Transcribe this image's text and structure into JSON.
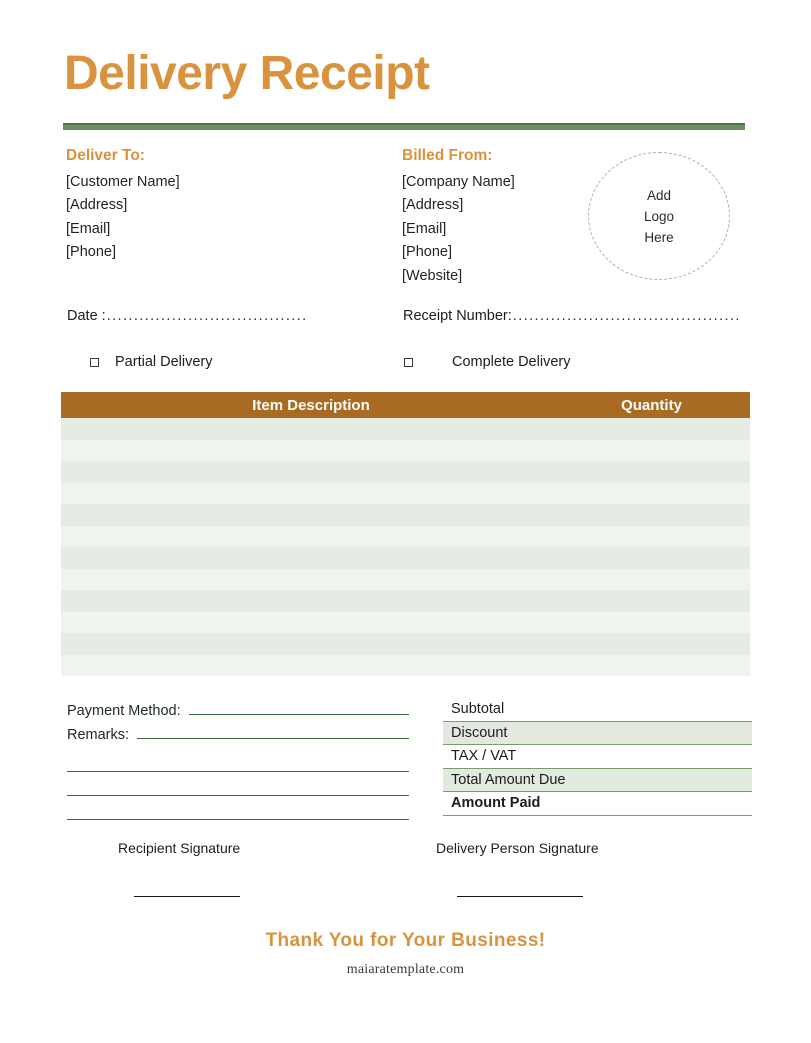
{
  "document": {
    "title": "Delivery Receipt"
  },
  "colors": {
    "accent_orange": "#d9933f",
    "rule_green": "#6b8e5e",
    "table_header_brown": "#a96b22",
    "row_shade_dark": "#e6ece3",
    "row_shade_light": "#f0f4ef",
    "logo_dash": "#9fb3b8",
    "underline_green": "#3c6b3c"
  },
  "deliver_to": {
    "heading": "Deliver To:",
    "lines": [
      "[Customer Name]",
      "[Address]",
      "[Email]",
      "[Phone]"
    ]
  },
  "billed_from": {
    "heading": "Billed From:",
    "lines": [
      "[Company Name]",
      "[Address]",
      "[Email]",
      "[Phone]",
      "[Website]"
    ]
  },
  "logo": {
    "line1": "Add",
    "line2": "Logo",
    "line3": "Here"
  },
  "meta": {
    "date_label": "Date :",
    "date_leader": "..................................................",
    "receipt_label": "Receipt Number:",
    "receipt_leader": "........................................................."
  },
  "delivery_type": {
    "partial_label": "Partial Delivery",
    "complete_label": "Complete Delivery"
  },
  "items_table": {
    "columns": [
      "Item Description",
      "Quantity"
    ],
    "row_count": 12,
    "rows": [
      {
        "description": "",
        "quantity": ""
      },
      {
        "description": "",
        "quantity": ""
      },
      {
        "description": "",
        "quantity": ""
      },
      {
        "description": "",
        "quantity": ""
      },
      {
        "description": "",
        "quantity": ""
      },
      {
        "description": "",
        "quantity": ""
      },
      {
        "description": "",
        "quantity": ""
      },
      {
        "description": "",
        "quantity": ""
      },
      {
        "description": "",
        "quantity": ""
      },
      {
        "description": "",
        "quantity": ""
      },
      {
        "description": "",
        "quantity": ""
      },
      {
        "description": "",
        "quantity": ""
      }
    ]
  },
  "payment": {
    "method_label": "Payment Method:",
    "method_value": "",
    "remarks_label": "Remarks:",
    "remarks_value": "",
    "extra_line_count": 3
  },
  "totals": {
    "rows": [
      {
        "label": "Subtotal",
        "value": "",
        "shaded": false,
        "bold": false
      },
      {
        "label": "Discount",
        "value": "",
        "shaded": true,
        "bold": false
      },
      {
        "label": "TAX / VAT",
        "value": "",
        "shaded": false,
        "bold": false
      },
      {
        "label": "Total Amount Due",
        "value": "",
        "shaded": true,
        "bold": false
      },
      {
        "label": "Amount Paid",
        "value": "",
        "shaded": false,
        "bold": true
      }
    ]
  },
  "signatures": {
    "recipient_label": "Recipient Signature",
    "delivery_label": "Delivery Person Signature"
  },
  "footer": {
    "thanks": "Thank You for Your Business!",
    "website": "maiaratemplate.com"
  }
}
